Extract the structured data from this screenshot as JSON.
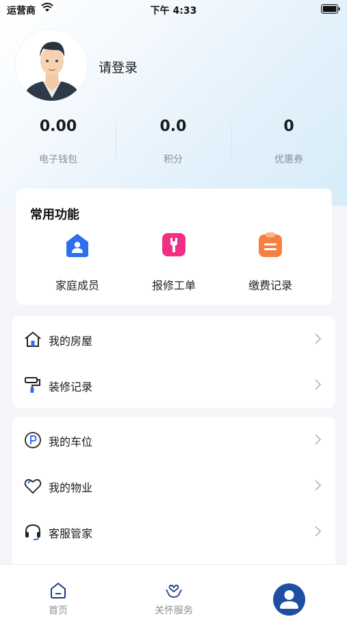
{
  "status_bar": {
    "carrier": "运营商",
    "time": "下午 4:33"
  },
  "profile": {
    "login_text": "请登录"
  },
  "stats": [
    {
      "value": "0.00",
      "label": "电子钱包"
    },
    {
      "value": "0.0",
      "label": "积分"
    },
    {
      "value": "0",
      "label": "优惠券"
    }
  ],
  "functions": {
    "title": "常用功能",
    "items": [
      {
        "label": "家庭成员",
        "icon": "family-icon",
        "color": "#2e6ff0"
      },
      {
        "label": "报修工单",
        "icon": "repair-icon",
        "color": "#f02f85"
      },
      {
        "label": "缴费记录",
        "icon": "clipboard-icon",
        "color": "#f58140"
      }
    ]
  },
  "menu_group_1": [
    {
      "label": "我的房屋",
      "icon": "house-icon"
    },
    {
      "label": "装修记录",
      "icon": "paint-roller-icon"
    }
  ],
  "menu_group_2": [
    {
      "label": "我的车位",
      "icon": "parking-icon"
    },
    {
      "label": "我的物业",
      "icon": "heart-icon"
    },
    {
      "label": "客服管家",
      "icon": "headset-icon"
    }
  ],
  "tabbar": [
    {
      "label": "首页",
      "icon": "home-icon"
    },
    {
      "label": "关怀服务",
      "icon": "care-icon"
    },
    {
      "label": "",
      "icon": "user-icon"
    }
  ],
  "colors": {
    "accent": "#2e6ff0",
    "tab_active": "#1f4fa3",
    "muted": "#8a8f96"
  }
}
